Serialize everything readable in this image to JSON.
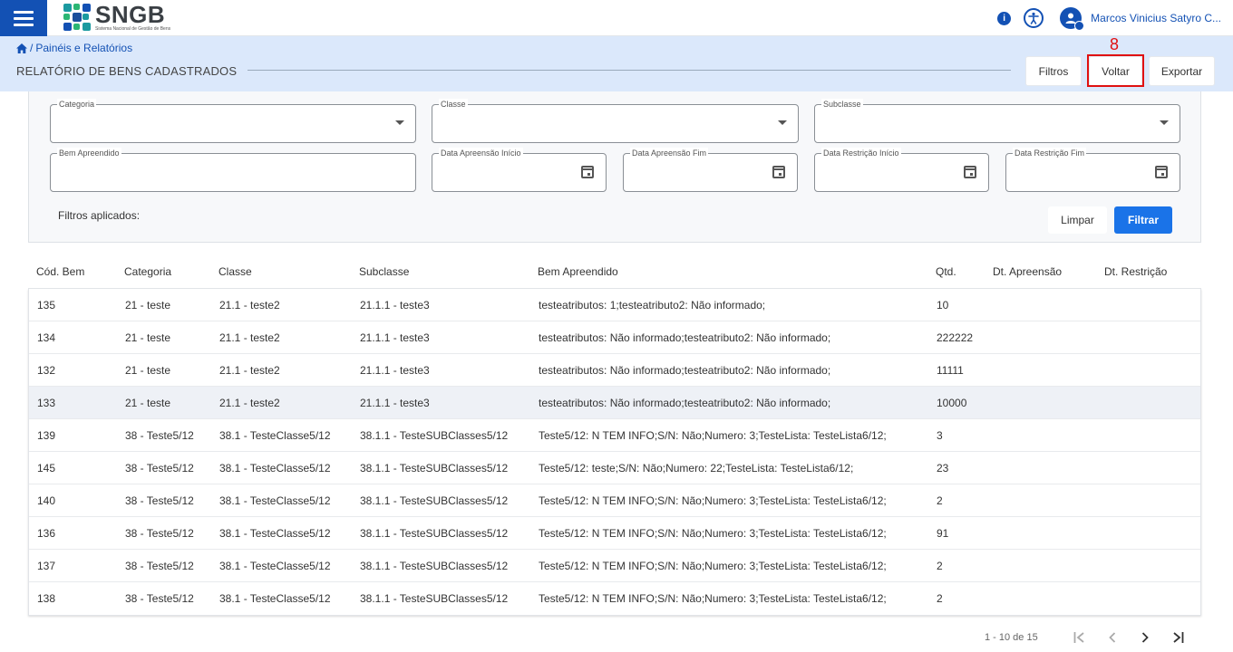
{
  "topbar": {
    "app_title": "SNGB",
    "app_subtitle": "Sistema Nacional de Gestão de Bens",
    "user_name": "Marcos Vinicius Satyro C...",
    "info_icon": "info-icon",
    "accessibility_icon": "accessibility-icon",
    "user_icon": "user-avatar-icon",
    "brand_color": "#1351b4"
  },
  "breadcrumb": {
    "separator": "/",
    "current": "Painéis e Relatórios"
  },
  "page": {
    "title": "RELATÓRIO DE BENS CADASTRADOS"
  },
  "header_buttons": {
    "filtros": "Filtros",
    "voltar": "Voltar",
    "exportar": "Exportar"
  },
  "annotation": {
    "number": "8",
    "color": "#e01010"
  },
  "filters": {
    "categoria": "Categoria",
    "classe": "Classe",
    "subclasse": "Subclasse",
    "bem_apreendido": "Bem Apreendido",
    "data_apreensao_inicio": "Data Apreensão Início",
    "data_apreensao_fim": "Data Apreensão Fim",
    "data_restricao_inicio": "Data Restrição Início",
    "data_restricao_fim": "Data Restrição Fim",
    "applied_label": "Filtros aplicados:",
    "limpar": "Limpar",
    "filtrar": "Filtrar"
  },
  "table": {
    "columns": [
      "Cód. Bem",
      "Categoria",
      "Classe",
      "Subclasse",
      "Bem Apreendido",
      "Qtd.",
      "Dt. Apreensão",
      "Dt. Restrição"
    ],
    "rows": [
      [
        "135",
        "21 - teste",
        "21.1 - teste2",
        "21.1.1 - teste3",
        "testeatributos: 1;testeatributo2: Não informado;",
        "10",
        "",
        ""
      ],
      [
        "134",
        "21 - teste",
        "21.1 - teste2",
        "21.1.1 - teste3",
        "testeatributos: Não informado;testeatributo2: Não informado;",
        "222222",
        "",
        ""
      ],
      [
        "132",
        "21 - teste",
        "21.1 - teste2",
        "21.1.1 - teste3",
        "testeatributos: Não informado;testeatributo2: Não informado;",
        "11111",
        "",
        ""
      ],
      [
        "133",
        "21 - teste",
        "21.1 - teste2",
        "21.1.1 - teste3",
        "testeatributos: Não informado;testeatributo2: Não informado;",
        "10000",
        "",
        ""
      ],
      [
        "139",
        "38 - Teste5/12",
        "38.1 - TesteClasse5/12",
        "38.1.1 - TesteSUBClasses5/12",
        "Teste5/12: N TEM INFO;S/N: Não;Numero: 3;TesteLista: TesteLista6/12;",
        "3",
        "",
        ""
      ],
      [
        "145",
        "38 - Teste5/12",
        "38.1 - TesteClasse5/12",
        "38.1.1 - TesteSUBClasses5/12",
        "Teste5/12: teste;S/N: Não;Numero: 22;TesteLista: TesteLista6/12;",
        "23",
        "",
        ""
      ],
      [
        "140",
        "38 - Teste5/12",
        "38.1 - TesteClasse5/12",
        "38.1.1 - TesteSUBClasses5/12",
        "Teste5/12: N TEM INFO;S/N: Não;Numero: 3;TesteLista: TesteLista6/12;",
        "2",
        "",
        ""
      ],
      [
        "136",
        "38 - Teste5/12",
        "38.1 - TesteClasse5/12",
        "38.1.1 - TesteSUBClasses5/12",
        "Teste5/12: N TEM INFO;S/N: Não;Numero: 3;TesteLista: TesteLista6/12;",
        "91",
        "",
        ""
      ],
      [
        "137",
        "38 - Teste5/12",
        "38.1 - TesteClasse5/12",
        "38.1.1 - TesteSUBClasses5/12",
        "Teste5/12: N TEM INFO;S/N: Não;Numero: 3;TesteLista: TesteLista6/12;",
        "2",
        "",
        ""
      ],
      [
        "138",
        "38 - Teste5/12",
        "38.1 - TesteClasse5/12",
        "38.1.1 - TesteSUBClasses5/12",
        "Teste5/12: N TEM INFO;S/N: Não;Numero: 3;TesteLista: TesteLista6/12;",
        "2",
        "",
        ""
      ]
    ],
    "highlighted_row": 3
  },
  "pagination": {
    "range": "1 - 10 de 15",
    "first": "|‹",
    "prev": "‹",
    "next": "›",
    "last": "›|"
  }
}
